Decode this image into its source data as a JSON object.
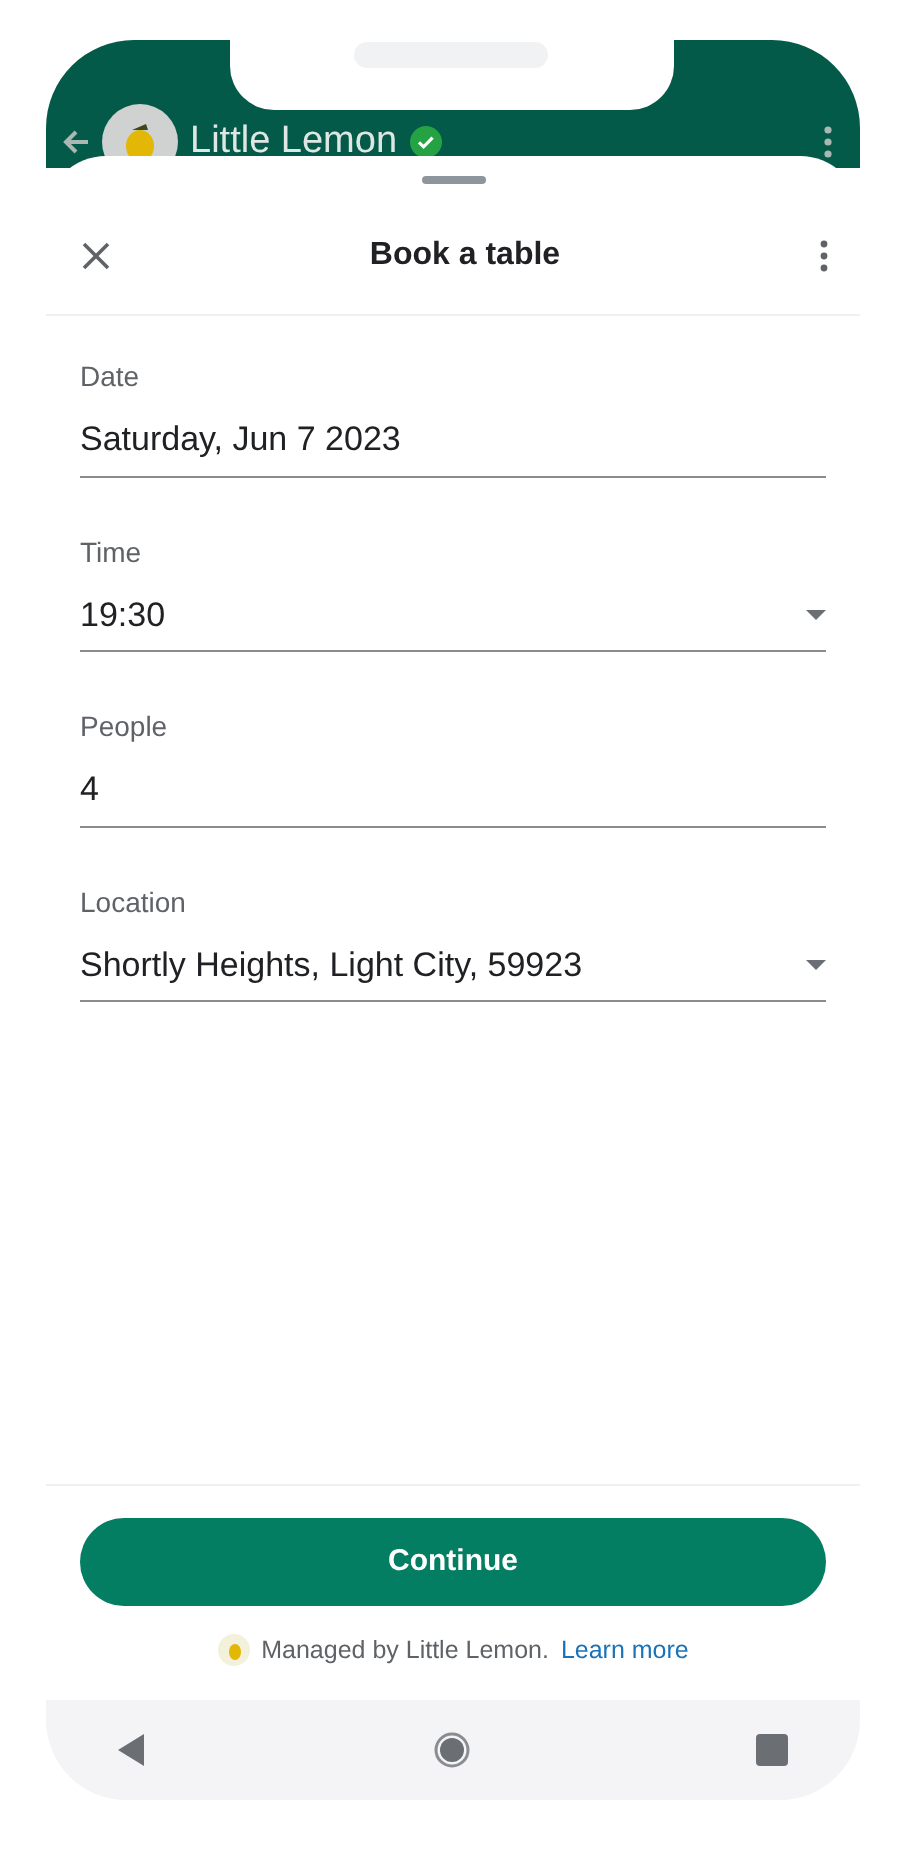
{
  "app_header": {
    "title": "Little Lemon",
    "verified": true
  },
  "sheet": {
    "title": "Book a table"
  },
  "fields": [
    {
      "label": "Date",
      "value": "Saturday, Jun 7 2023",
      "kind": "text"
    },
    {
      "label": "Time",
      "value": "19:30",
      "kind": "select"
    },
    {
      "label": "People",
      "value": "4",
      "kind": "text"
    },
    {
      "label": "Location",
      "value": "Shortly Heights, Light City, 59923",
      "kind": "select"
    }
  ],
  "primary_button": "Continue",
  "footer": {
    "text": "Managed by Little Lemon.",
    "link": "Learn more"
  }
}
